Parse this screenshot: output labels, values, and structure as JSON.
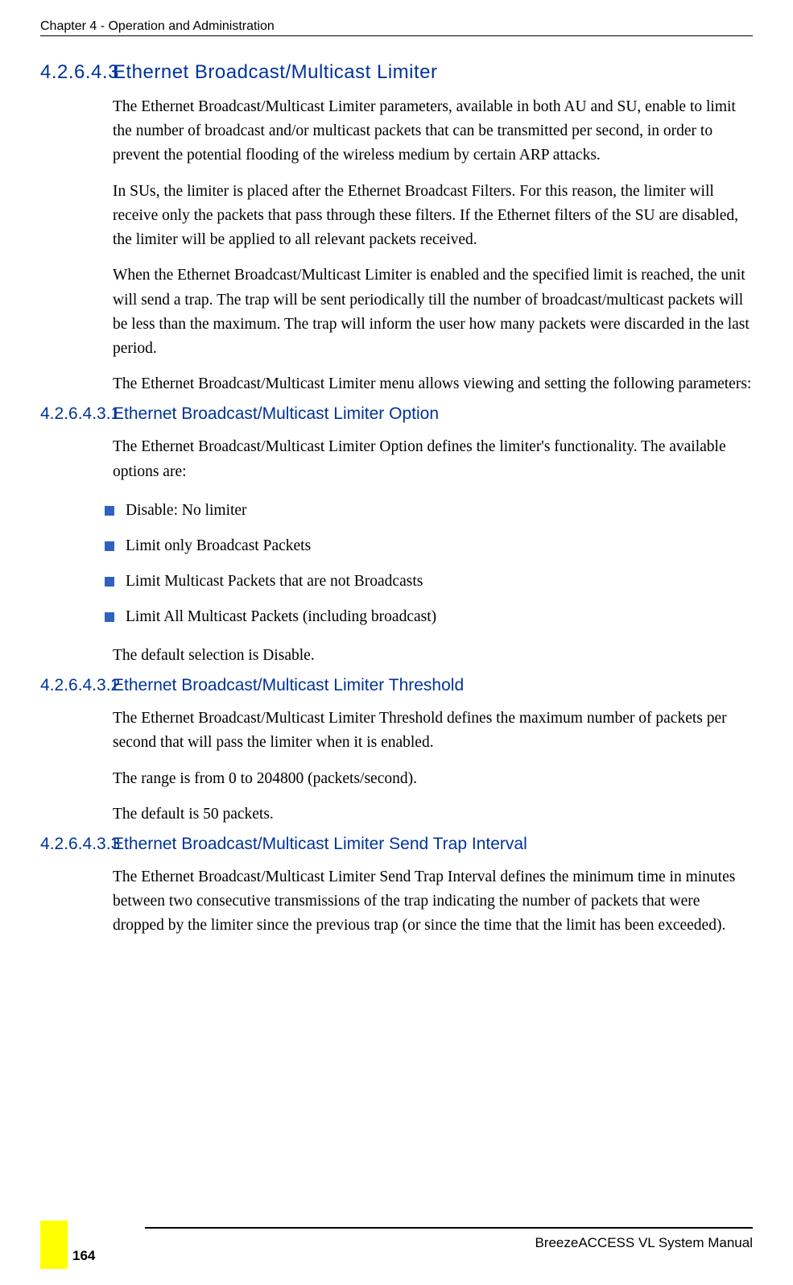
{
  "header": {
    "chapter": "Chapter 4 - Operation and Administration"
  },
  "s1": {
    "num": "4.2.6.4.3",
    "title": "Ethernet Broadcast/Multicast Limiter",
    "p1": "The Ethernet Broadcast/Multicast Limiter parameters, available in both AU and SU, enable to limit the number of broadcast and/or multicast packets that can be transmitted per second, in order to prevent the potential flooding of the wireless medium by certain ARP attacks.",
    "p2": "In SUs, the limiter is placed after the Ethernet Broadcast Filters. For this reason, the limiter will receive only the packets that pass through these filters. If the Ethernet filters of the SU are disabled, the limiter will be applied to all relevant packets received.",
    "p3": "When the Ethernet Broadcast/Multicast Limiter is enabled and the specified limit is reached, the unit will send a trap. The trap will be sent periodically till the number of broadcast/multicast packets will be less than the maximum. The trap will inform the user how many packets were discarded in the last period.",
    "p4": "The Ethernet Broadcast/Multicast Limiter menu allows viewing and setting the following parameters:"
  },
  "s2": {
    "num": "4.2.6.4.3.1",
    "title": "Ethernet Broadcast/Multicast Limiter Option",
    "p1": "The Ethernet Broadcast/Multicast Limiter Option defines the limiter's functionality. The available options are:",
    "bullets": [
      "Disable: No limiter",
      "Limit only Broadcast Packets",
      "Limit Multicast Packets that are not Broadcasts",
      "Limit All Multicast Packets (including broadcast)"
    ],
    "p2": "The default selection is Disable."
  },
  "s3": {
    "num": "4.2.6.4.3.2",
    "title": "Ethernet Broadcast/Multicast Limiter Threshold",
    "p1": "The Ethernet Broadcast/Multicast Limiter Threshold defines the maximum number of packets per second that will pass the limiter when it is enabled.",
    "p2": "The range is from 0 to 204800 (packets/second).",
    "p3": "The default is 50 packets."
  },
  "s4": {
    "num": "4.2.6.4.3.3",
    "title": "Ethernet Broadcast/Multicast Limiter Send Trap Interval",
    "p1": "The Ethernet Broadcast/Multicast Limiter Send Trap Interval defines the minimum time in minutes between two consecutive transmissions of the trap indicating the number of packets that were dropped by the limiter since the previous trap (or since the time that the limit has been exceeded)."
  },
  "footer": {
    "manual": "BreezeACCESS VL System Manual",
    "page": "164"
  }
}
